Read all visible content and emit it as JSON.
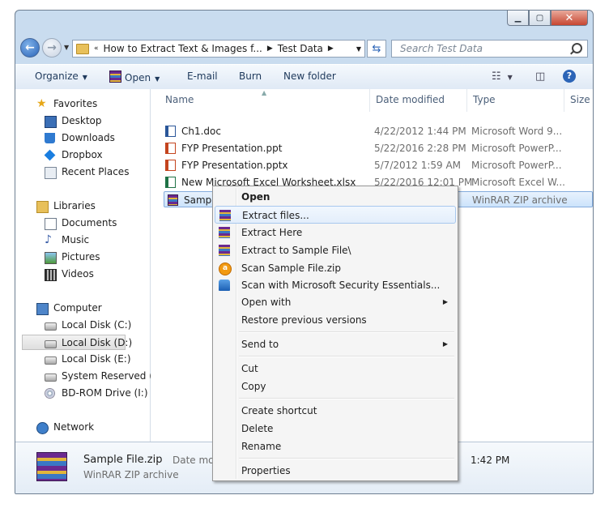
{
  "address": {
    "crumbs": [
      "How to Extract Text & Images f...",
      "Test Data"
    ]
  },
  "search": {
    "placeholder": "Search Test Data"
  },
  "toolbar": {
    "organize": "Organize",
    "open": "Open",
    "email": "E-mail",
    "burn": "Burn",
    "new_folder": "New folder"
  },
  "sidebar": {
    "favorites": "Favorites",
    "fav_items": [
      "Desktop",
      "Downloads",
      "Dropbox",
      "Recent Places"
    ],
    "libraries": "Libraries",
    "lib_items": [
      "Documents",
      "Music",
      "Pictures",
      "Videos"
    ],
    "computer": "Computer",
    "comp_items": [
      "Local Disk (C:)",
      "Local Disk (D:)",
      "Local Disk (E:)",
      "System Reserved (H:",
      "BD-ROM Drive (I:) P:"
    ],
    "network": "Network"
  },
  "columns": {
    "name": "Name",
    "date": "Date modified",
    "type": "Type",
    "size": "Size"
  },
  "files": [
    {
      "name": "Ch1.doc",
      "date": "4/22/2012 1:44 PM",
      "type": "Microsoft Word 9...",
      "icon": "word-icon"
    },
    {
      "name": "FYP Presentation.ppt",
      "date": "5/22/2016 2:28 PM",
      "type": "Microsoft PowerP...",
      "icon": "powerpoint-icon"
    },
    {
      "name": "FYP Presentation.pptx",
      "date": "5/7/2012 1:59 AM",
      "type": "Microsoft PowerP...",
      "icon": "powerpoint-icon"
    },
    {
      "name": "New Microsoft Excel Worksheet.xlsx",
      "date": "5/22/2016 12:01 PM",
      "type": "Microsoft Excel W...",
      "icon": "excel-icon"
    },
    {
      "name": "Sample",
      "date": "",
      "type": "WinRAR ZIP archive",
      "icon": "winrar-icon"
    }
  ],
  "details": {
    "name": "Sample File.zip",
    "type": "WinRAR ZIP archive",
    "date_label": "Date moc",
    "time": "1:42 PM"
  },
  "context_menu": {
    "open": "Open",
    "extract_files": "Extract files...",
    "extract_here": "Extract Here",
    "extract_to": "Extract to Sample File\\",
    "scan_avast": "Scan Sample File.zip",
    "scan_mse": "Scan with Microsoft Security Essentials...",
    "open_with": "Open with",
    "restore": "Restore previous versions",
    "send_to": "Send to",
    "cut": "Cut",
    "copy": "Copy",
    "create_shortcut": "Create shortcut",
    "delete": "Delete",
    "rename": "Rename",
    "properties": "Properties"
  }
}
